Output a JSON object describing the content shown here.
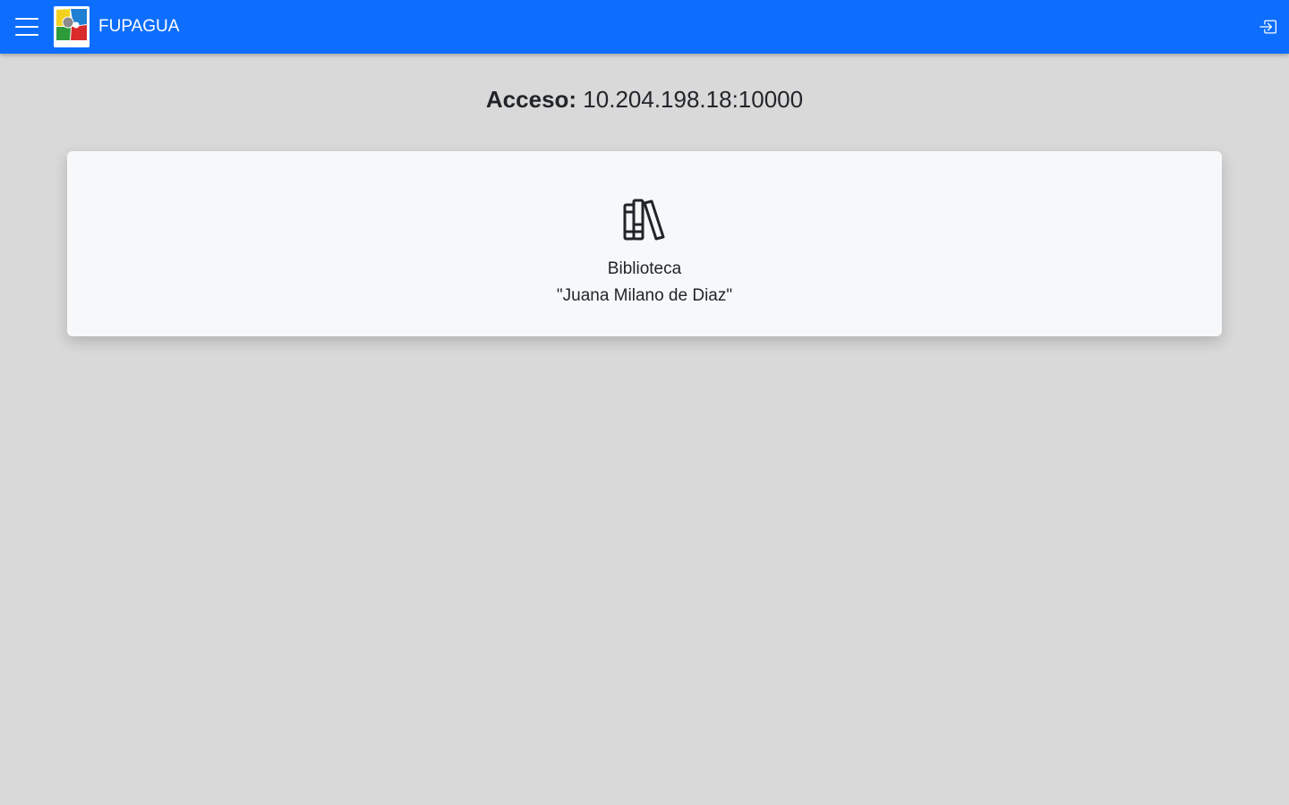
{
  "navbar": {
    "brand": "FUPAGUA",
    "logo_text": "FUPAGUA",
    "menu_icon": "hamburger-menu-icon",
    "login_icon": "box-arrow-in-right-icon",
    "background_color": "#0d6efd"
  },
  "access": {
    "label": "Acceso:",
    "value": "10.204.198.18:10000"
  },
  "card": {
    "icon": "books-icon",
    "title_line1": "Biblioteca",
    "title_line2": "\"Juana Milano de Diaz\""
  }
}
